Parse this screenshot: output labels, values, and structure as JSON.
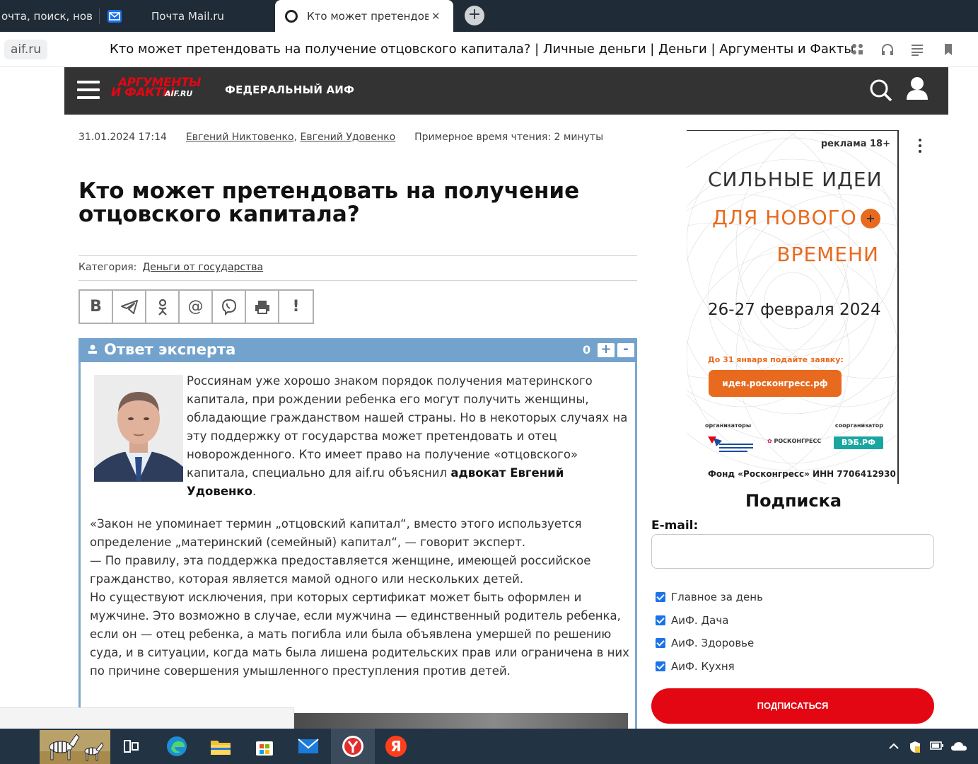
{
  "browser": {
    "tabs": [
      {
        "title": "очта, поиск, нов"
      },
      {
        "title": "Почта Mail.ru"
      },
      {
        "title": "Кто может претендоват"
      }
    ],
    "new_tab_label": "+",
    "close_label": "✕",
    "domain": "aif.ru",
    "page_title": "Кто может претендовать на получение отцовского капитала? | Личные деньги | Деньги | Аргументы и Факты"
  },
  "header": {
    "logo_top": "АРГУМЕНТЫ",
    "logo_bottom": "И ФАКТЫ",
    "logo_domain": "AIF.RU",
    "section": "ФЕДЕРАЛЬНЫЙ АИФ"
  },
  "article": {
    "date": "31.01.2024 17:14",
    "author1": "Евгений Никтовенко",
    "author_sep": ", ",
    "author2": "Евгений Удовенко",
    "read_time": "Примерное время чтения: 2 минуты",
    "title": "Кто может претендовать на получение отцовского капитала?",
    "category_label": "Категория:",
    "category_link": "Деньги от государства",
    "share": [
      "В",
      "✈",
      "ok",
      "@",
      "viber",
      "print",
      "!"
    ]
  },
  "expert": {
    "title": "Ответ эксперта",
    "votes": "0",
    "plus": "+",
    "minus": "-",
    "intro": "Россиянам уже хорошо знаком порядок получения материнского капитала, при рождении ребенка его могут получить женщины, обладающие гражданством нашей страны. Но в некоторых случаях на эту поддержку от государства может претендовать и отец новорожденного. Кто имеет право на получение «отцовского» капитала, специально для aif.ru объяснил ",
    "intro_bold": "адвокат Евгений Удовенко",
    "intro_end": ".",
    "quote1": "«Закон не упоминает термин „отцовский капитал“, вместо этого используется определение „материнский (семейный) капитал“, — говорит эксперт.",
    "quote2": "— По правилу, эта поддержка предоставляется женщине, имеющей российское гражданство, которая является мамой одного или нескольких детей.",
    "quote3": "Но существуют исключения, при которых сертификат может быть оформлен и мужчине. Это возможно в случае, если мужчина — единственный родитель ребенка, если он — отец ребенка, а мать погибла или была объявлена умершей по решению суда, и в ситуации, когда мать была лишена родительских прав или ограничена в них по причине совершения умышленного преступления против детей."
  },
  "ad": {
    "label": "реклама 18+",
    "line1": "СИЛЬНЫЕ ИДЕИ",
    "line2": "ДЛЯ НОВОГО",
    "line3": "ВРЕМЕНИ",
    "plus": "+",
    "date": "26-27 февраля 2024",
    "deadline": "До 31 января подайте заявку:",
    "button": "идея.росконгресс.рф",
    "organizers": "организаторы",
    "coorganizer": "соорганизатор",
    "logo2": "РОСКОНГРЕСС",
    "logo3": "ВЭБ.РФ",
    "footer": "Фонд «Росконгресс» ИНН 7706412930"
  },
  "subscription": {
    "title": "Подписка",
    "email_label": "E-mail:",
    "email_value": "",
    "options": [
      "Главное за день",
      "АиФ. Дача",
      "АиФ. Здоровье",
      "АиФ. Кухня"
    ],
    "button": "ПОДПИСАТЬСЯ"
  },
  "taskbar": {
    "apps": [
      "task-view",
      "edge",
      "explorer",
      "store",
      "mail",
      "yandex-browser",
      "yandex"
    ]
  },
  "colors": {
    "header_bg": "#333333",
    "expert_blue": "#73a3cc",
    "ad_orange": "#e86a1f",
    "subscribe_red": "#e30613"
  }
}
